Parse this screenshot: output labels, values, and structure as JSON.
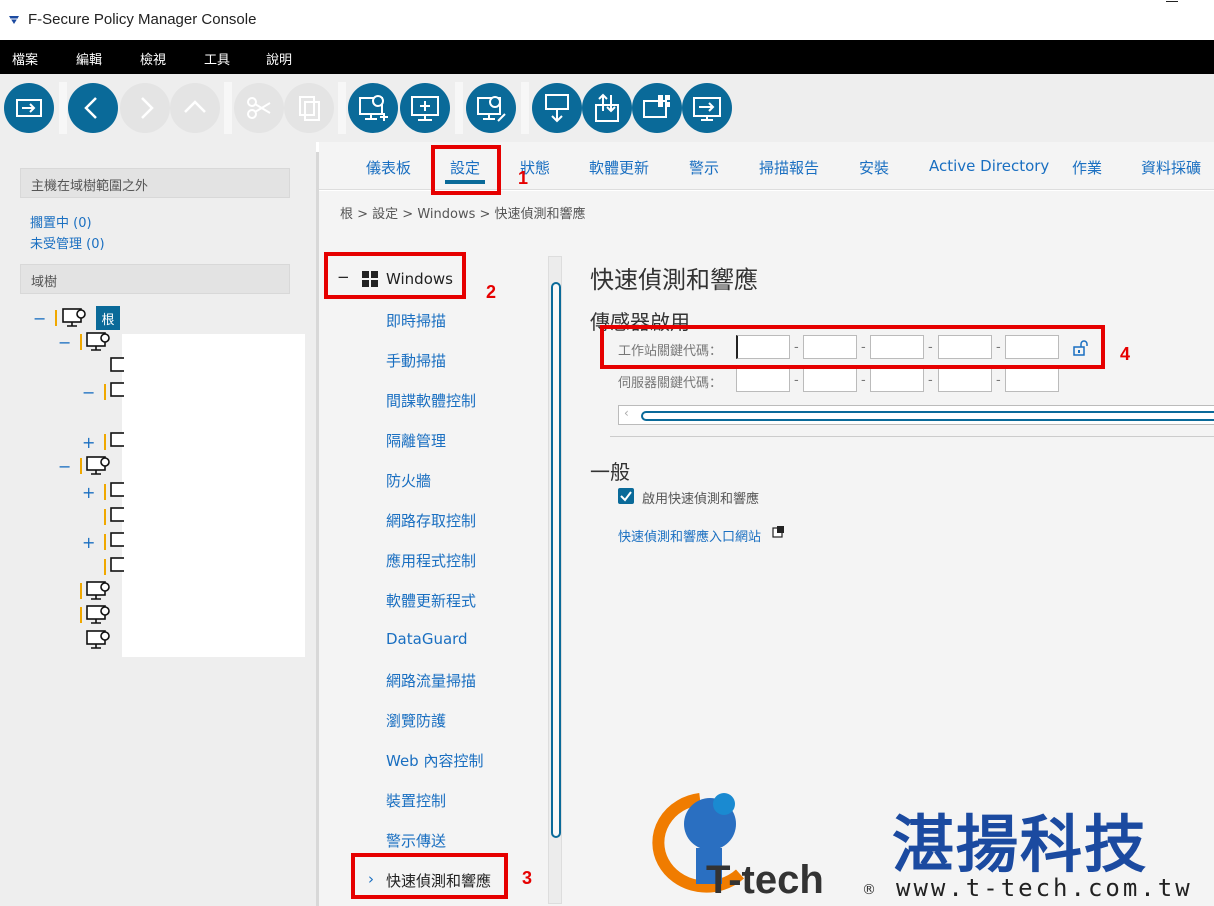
{
  "window": {
    "title": "F-Secure Policy Manager Console"
  },
  "menu": {
    "items": [
      "檔案",
      "編輯",
      "檢視",
      "工具",
      "說明"
    ]
  },
  "toolbar": {
    "buttons": [
      {
        "icon": "import-export-icon",
        "enabled": true
      },
      {
        "icon": "back-arrow-icon",
        "enabled": true
      },
      {
        "icon": "forward-arrow-icon",
        "enabled": false
      },
      {
        "icon": "up-arrow-icon",
        "enabled": false
      },
      {
        "icon": "cut-icon",
        "enabled": false
      },
      {
        "icon": "copy-icon",
        "enabled": false
      },
      {
        "icon": "add-host-icon",
        "enabled": true
      },
      {
        "icon": "new-domain-icon",
        "enabled": true
      },
      {
        "icon": "edit-host-icon",
        "enabled": true
      },
      {
        "icon": "distribute-policy-icon",
        "enabled": true
      },
      {
        "icon": "install-icon",
        "enabled": true
      },
      {
        "icon": "windows-install-icon",
        "enabled": true
      },
      {
        "icon": "export-host-icon",
        "enabled": true
      }
    ],
    "accent_color": "#0a6a99"
  },
  "left_panel": {
    "outside_header": "主機在域樹範圍之外",
    "pending_label": "擱置中",
    "pending_count": "(0)",
    "unmanaged_label": "未受管理",
    "unmanaged_count": "(0)",
    "domain_tree_header": "域樹",
    "root_label": "根"
  },
  "tabs": {
    "items": [
      "儀表板",
      "設定",
      "狀態",
      "軟體更新",
      "警示",
      "掃描報告",
      "安裝",
      "Active Directory",
      "作業",
      "資料採礦"
    ],
    "active": "設定"
  },
  "breadcrumb": "根 > 設定 > Windows > 快速偵測和響應",
  "settings_nav": {
    "group_label": "Windows",
    "group_toggle": "−",
    "items": [
      "即時掃描",
      "手動掃描",
      "間諜軟體控制",
      "隔離管理",
      "防火牆",
      "網路存取控制",
      "應用程式控制",
      "軟體更新程式",
      "DataGuard",
      "網路流量掃描",
      "瀏覽防護",
      "Web 內容控制",
      "裝置控制",
      "警示傳送"
    ],
    "selected": "快速偵測和響應",
    "selected_chevron": "›"
  },
  "main": {
    "title": "快速偵測和響應",
    "sensor_section": "傳感器啟用",
    "workstation_key_label": "工作站關鍵代碼：",
    "server_key_label": "伺服器關鍵代碼：",
    "general_section": "一般",
    "enable_checkbox_label": "啟用快速偵測和響應",
    "enable_checked": true,
    "portal_link": "快速偵測和響應入口網站"
  },
  "annotations": {
    "n1": "1",
    "n2": "2",
    "n3": "3",
    "n4": "4",
    "color": "#e60000"
  },
  "watermark": {
    "chinese": "湛揚科技",
    "brand": "T-tech",
    "reg": "®",
    "url": "www.t-tech.com.tw"
  }
}
